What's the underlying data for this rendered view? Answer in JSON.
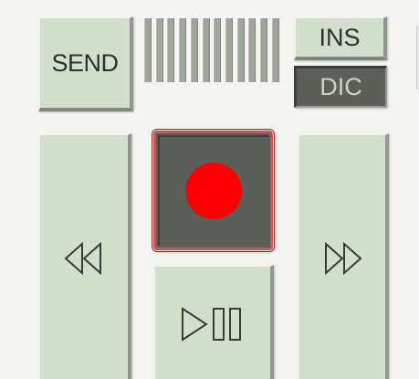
{
  "controls": {
    "send_label": "SEND",
    "ins_label": "INS",
    "dic_label": "DIC",
    "level_meter_bars": 12,
    "record_icon": "record-icon",
    "rewind_icon": "rewind-icon",
    "fast_forward_icon": "fast-forward-icon",
    "play_pause_icon": "play-pause-icon"
  },
  "colors": {
    "button_face": "#d3dfcd",
    "button_active": "#5a5f58",
    "record_dot": "#ff0000",
    "record_border": "#b85c5c",
    "background": "#f4f4f2"
  }
}
